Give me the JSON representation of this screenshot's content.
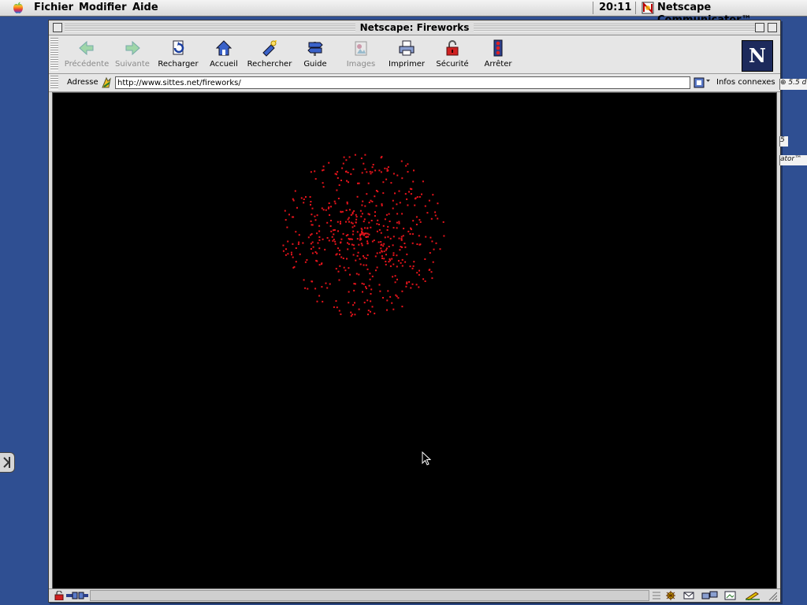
{
  "menubar": {
    "items": [
      "Fichier",
      "Modifier",
      "Aide"
    ],
    "clock": "20:11",
    "app_name": "Netscape Communicator™"
  },
  "window": {
    "title": "Netscape: Fireworks"
  },
  "toolbar": {
    "buttons": [
      {
        "label": "Précédente",
        "icon": "back-arrow-icon",
        "enabled": false
      },
      {
        "label": "Suivante",
        "icon": "forward-arrow-icon",
        "enabled": false
      },
      {
        "label": "Recharger",
        "icon": "reload-icon",
        "enabled": true
      },
      {
        "label": "Accueil",
        "icon": "home-icon",
        "enabled": true
      },
      {
        "label": "Rechercher",
        "icon": "search-icon",
        "enabled": true
      },
      {
        "label": "Guide",
        "icon": "guide-icon",
        "enabled": true
      },
      {
        "label": "Images",
        "icon": "images-icon",
        "enabled": false
      },
      {
        "label": "Imprimer",
        "icon": "print-icon",
        "enabled": true
      },
      {
        "label": "Sécurité",
        "icon": "security-lock-icon",
        "enabled": true
      },
      {
        "label": "Arrêter",
        "icon": "stop-icon",
        "enabled": true
      }
    ],
    "logo_letter": "N"
  },
  "location": {
    "label": "Adresse",
    "url": "http://www.sittes.net/fireworks/",
    "related_label": "Infos connexes"
  },
  "page": {
    "background": "#000000",
    "particle_color": "#e8141c"
  },
  "desktop": {
    "fragments": [
      "⊕ 5.5 d",
      "5",
      "ator™"
    ]
  }
}
